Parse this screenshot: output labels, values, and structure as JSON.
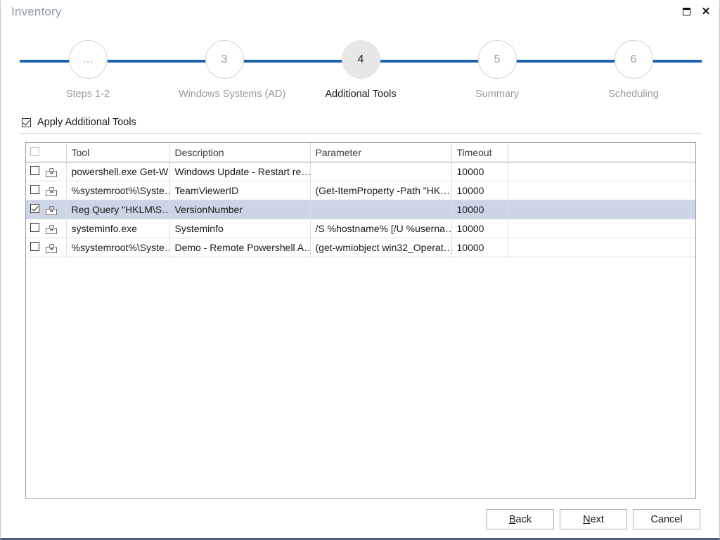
{
  "window": {
    "title": "Inventory",
    "maximize_icon": "maximize-icon",
    "close_icon": "close-icon"
  },
  "stepper": {
    "steps": [
      {
        "number": "…",
        "label": "Steps 1-2",
        "active": false
      },
      {
        "number": "3",
        "label": "Windows Systems (AD)",
        "active": false
      },
      {
        "number": "4",
        "label": "Additional Tools",
        "active": true
      },
      {
        "number": "5",
        "label": "Summary",
        "active": false
      },
      {
        "number": "6",
        "label": "Scheduling",
        "active": false
      }
    ],
    "line_color": "#1c62ac",
    "active_circle_color": "#e7e7e7"
  },
  "apply": {
    "label": "Apply Additional Tools",
    "checked": true
  },
  "table": {
    "columns": [
      "",
      "",
      "Tool",
      "Description",
      "Parameter",
      "Timeout",
      ""
    ],
    "header_checkbox_checked": false,
    "selection_color": "#cbd5e5",
    "rows": [
      {
        "checked": false,
        "icon": "toolbox-icon",
        "tool": "powershell.exe Get-W…",
        "description": "Windows Update - Restart re…",
        "parameter": "",
        "timeout": "10000",
        "selected": false
      },
      {
        "checked": false,
        "icon": "toolbox-icon",
        "tool": "%systemroot%\\Syste…",
        "description": "TeamViewerID",
        "parameter": "(Get-ItemProperty -Path \"HK…",
        "timeout": "10000",
        "selected": false
      },
      {
        "checked": true,
        "icon": "toolbox-icon",
        "tool": "Reg Query \"HKLM\\S…",
        "description": "VersionNumber",
        "parameter": "",
        "timeout": "10000",
        "selected": true
      },
      {
        "checked": false,
        "icon": "toolbox-icon",
        "tool": "systeminfo.exe",
        "description": "Systeminfo",
        "parameter": "/S %hostname% [/U %userna…",
        "timeout": "10000",
        "selected": false
      },
      {
        "checked": false,
        "icon": "toolbox-icon",
        "tool": "%systemroot%\\Syste…",
        "description": "Demo - Remote Powershell A…",
        "parameter": "(get-wmiobject win32_Operat…",
        "timeout": "10000",
        "selected": false
      }
    ]
  },
  "footer": {
    "back": {
      "accel": "B",
      "rest": "ack"
    },
    "next": {
      "accel": "N",
      "rest": "ext"
    },
    "cancel": "Cancel"
  }
}
